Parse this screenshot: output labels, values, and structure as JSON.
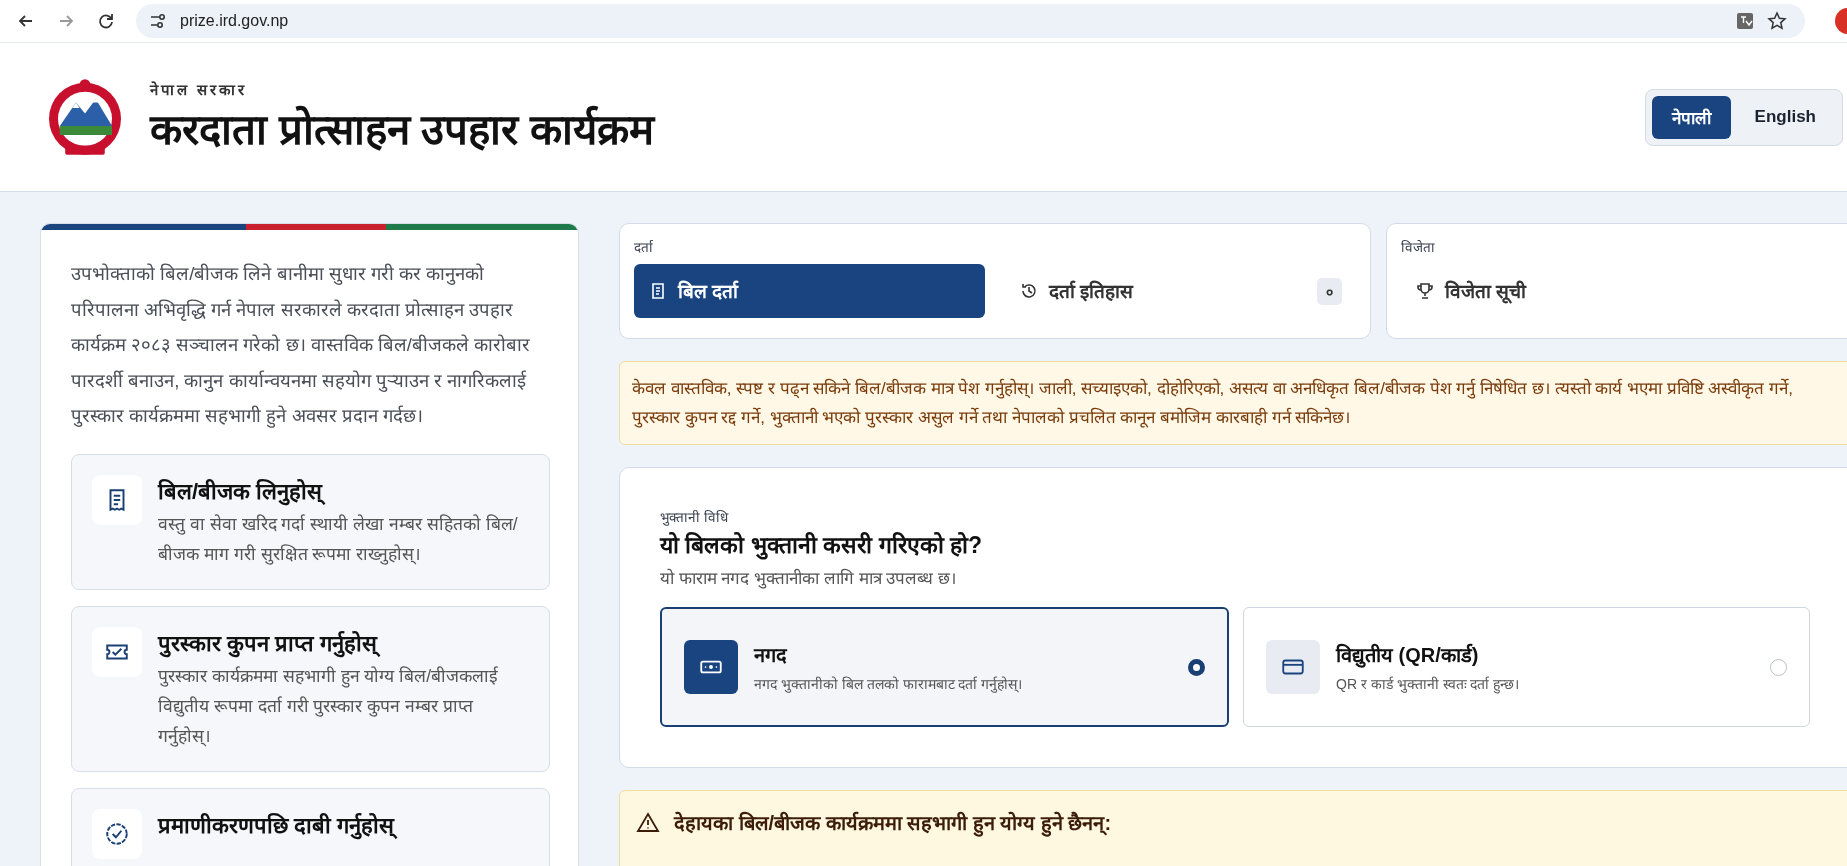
{
  "browser": {
    "url": "prize.ird.gov.np"
  },
  "header": {
    "subtitle": "नेपाल सरकार",
    "title": "करदाता प्रोत्साहन उपहार कार्यक्रम",
    "languages": [
      {
        "label": "नेपाली",
        "selected": true
      },
      {
        "label": "English",
        "selected": false
      }
    ]
  },
  "intro": {
    "text": "उपभोक्ताको बिल/बीजक लिने बानीमा सुधार गरी कर कानुनको परिपालना अभिवृद्धि गर्न नेपाल सरकारले करदाता प्रोत्साहन उपहार कार्यक्रम २०८३ सञ्चालन गरेको छ। वास्तविक बिल/बीजकले कारोबार पारदर्शी बनाउन, कानुन कार्यान्वयनमा सहयोग पुर्‍याउन र नागरिकलाई पुरस्कार कार्यक्रममा सहभागी हुने अवसर प्रदान गर्दछ।",
    "steps": [
      {
        "kind": "receipt",
        "title": "बिल/बीजक लिनुहोस्",
        "text": "वस्तु वा सेवा खरिद गर्दा स्थायी लेखा नम्बर सहितको बिल/बीजक माग गरी सुरक्षित रूपमा राख्नुहोस्।"
      },
      {
        "kind": "ticket",
        "title": "पुरस्कार कुपन प्राप्त गर्नुहोस्",
        "text": "पुरस्कार कार्यक्रममा सहभागी हुन योग्य बिल/बीजकलाई विद्युतीय रूपमा दर्ता गरी पुरस्कार कुपन नम्बर प्राप्त गर्नुहोस्।"
      },
      {
        "kind": "badge",
        "title": "प्रमाणीकरणपछि दाबी गर्नुहोस्"
      }
    ]
  },
  "registration": {
    "label": "दर्ता",
    "tabs": [
      {
        "kind": "list",
        "label": "बिल दर्ता",
        "selected": true
      },
      {
        "kind": "history",
        "label": "दर्ता इतिहास",
        "count": "०",
        "selected": false
      }
    ]
  },
  "winners": {
    "label": "विजेता",
    "tabs": [
      {
        "kind": "trophy",
        "label": "विजेता सूची",
        "selected": false
      }
    ]
  },
  "notice": "केवल वास्तविक, स्पष्ट र पढ्न सकिने बिल/बीजक मात्र पेश गर्नुहोस्। जाली, सच्याइएको, दोहोरिएको, असत्य वा अनधिकृत बिल/बीजक पेश गर्नु निषेधित छ। त्यस्तो कार्य भएमा प्रविष्टि अस्वीकृत गर्ने, पुरस्कार कुपन रद्द गर्ने, भुक्तानी भएको पुरस्कार असुल गर्ने तथा नेपालको प्रचलित कानून बमोजिम कारबाही गर्न सकिनेछ।",
  "payment": {
    "label": "भुक्तानी विधि",
    "question": "यो बिलको भुक्तानी कसरी गरिएको हो?",
    "hint": "यो फाराम नगद भुक्तानीका लागि मात्र उपलब्ध छ।",
    "options": [
      {
        "kind": "cash",
        "title": "नगद",
        "text": "नगद भुक्तानीको बिल तलको फारामबाट दर्ता गर्नुहोस्।",
        "selected": true
      },
      {
        "kind": "card",
        "title": "विद्युतीय (QR/कार्ड)",
        "text": "QR र कार्ड भुक्तानी स्वतः दर्ता हुन्छ।",
        "selected": false
      }
    ]
  },
  "ineligible": {
    "title": "देहायका बिल/बीजक कार्यक्रममा सहभागी हुन योग्य हुने छैनन्:"
  }
}
